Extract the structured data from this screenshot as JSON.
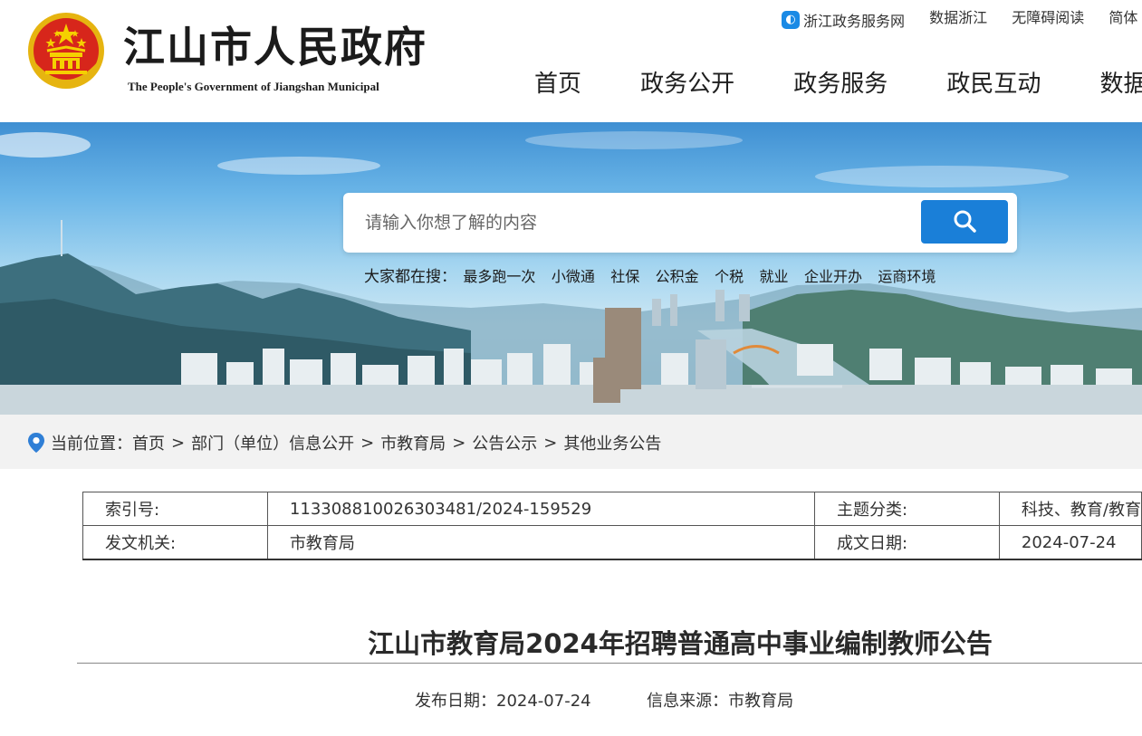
{
  "header": {
    "site_title": "江山市人民政府",
    "site_subtitle": "The People's Government of Jiangshan Municipal",
    "top_links": [
      {
        "label": "浙江政务服务网",
        "icon": "zhejiang-gov-icon"
      },
      {
        "label": "数据浙江"
      },
      {
        "label": "无障碍阅读"
      },
      {
        "label": "简体"
      }
    ],
    "nav": [
      "首页",
      "政务公开",
      "政务服务",
      "政民互动",
      "数据开放"
    ]
  },
  "search": {
    "placeholder": "请输入你想了解的内容",
    "button_icon": "search-icon",
    "hot_label": "大家都在搜：",
    "hot_terms": [
      "最多跑一次",
      "小微通",
      "社保",
      "公积金",
      "个税",
      "就业",
      "企业开办",
      "运商环境"
    ]
  },
  "breadcrumb": {
    "label": "当前位置：",
    "items": [
      "首页",
      "部门（单位）信息公开",
      "市教育局",
      "公告公示",
      "其他业务公告"
    ],
    "separator": ">"
  },
  "meta": {
    "index_label": "索引号:",
    "index_value": "11330881002630348​1/2024-159529",
    "topic_label": "主题分类:",
    "topic_value": "科技、教育/教育",
    "issuer_label": "发文机关:",
    "issuer_value": "市教育局",
    "date_label": "成文日期:",
    "date_value": "2024-07-24"
  },
  "article": {
    "title": "江山市教育局2024年招聘普通高中事业编制教师公告",
    "publish_label": "发布日期：",
    "publish_date": "2024-07-24",
    "source_label": "信息来源：",
    "source": "市教育局"
  },
  "colors": {
    "accent_blue": "#1a7fd8",
    "emblem_red": "#d7261b",
    "emblem_gold": "#f2c200"
  }
}
